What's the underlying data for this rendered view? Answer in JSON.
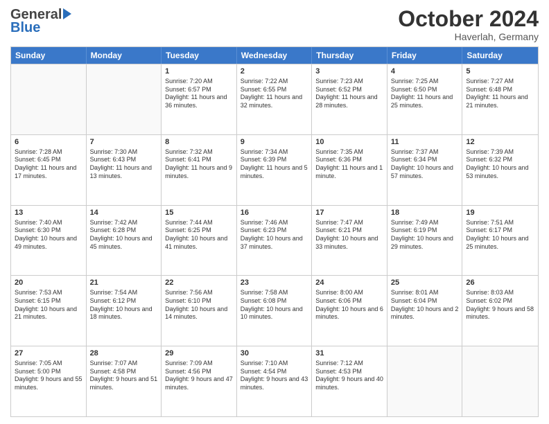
{
  "header": {
    "logo_general": "General",
    "logo_blue": "Blue",
    "month_title": "October 2024",
    "location": "Haverlah, Germany"
  },
  "days_of_week": [
    "Sunday",
    "Monday",
    "Tuesday",
    "Wednesday",
    "Thursday",
    "Friday",
    "Saturday"
  ],
  "weeks": [
    [
      {
        "day": "",
        "sunrise": "",
        "sunset": "",
        "daylight": "",
        "empty": true
      },
      {
        "day": "",
        "sunrise": "",
        "sunset": "",
        "daylight": "",
        "empty": true
      },
      {
        "day": "1",
        "sunrise": "Sunrise: 7:20 AM",
        "sunset": "Sunset: 6:57 PM",
        "daylight": "Daylight: 11 hours and 36 minutes.",
        "empty": false
      },
      {
        "day": "2",
        "sunrise": "Sunrise: 7:22 AM",
        "sunset": "Sunset: 6:55 PM",
        "daylight": "Daylight: 11 hours and 32 minutes.",
        "empty": false
      },
      {
        "day": "3",
        "sunrise": "Sunrise: 7:23 AM",
        "sunset": "Sunset: 6:52 PM",
        "daylight": "Daylight: 11 hours and 28 minutes.",
        "empty": false
      },
      {
        "day": "4",
        "sunrise": "Sunrise: 7:25 AM",
        "sunset": "Sunset: 6:50 PM",
        "daylight": "Daylight: 11 hours and 25 minutes.",
        "empty": false
      },
      {
        "day": "5",
        "sunrise": "Sunrise: 7:27 AM",
        "sunset": "Sunset: 6:48 PM",
        "daylight": "Daylight: 11 hours and 21 minutes.",
        "empty": false
      }
    ],
    [
      {
        "day": "6",
        "sunrise": "Sunrise: 7:28 AM",
        "sunset": "Sunset: 6:45 PM",
        "daylight": "Daylight: 11 hours and 17 minutes.",
        "empty": false
      },
      {
        "day": "7",
        "sunrise": "Sunrise: 7:30 AM",
        "sunset": "Sunset: 6:43 PM",
        "daylight": "Daylight: 11 hours and 13 minutes.",
        "empty": false
      },
      {
        "day": "8",
        "sunrise": "Sunrise: 7:32 AM",
        "sunset": "Sunset: 6:41 PM",
        "daylight": "Daylight: 11 hours and 9 minutes.",
        "empty": false
      },
      {
        "day": "9",
        "sunrise": "Sunrise: 7:34 AM",
        "sunset": "Sunset: 6:39 PM",
        "daylight": "Daylight: 11 hours and 5 minutes.",
        "empty": false
      },
      {
        "day": "10",
        "sunrise": "Sunrise: 7:35 AM",
        "sunset": "Sunset: 6:36 PM",
        "daylight": "Daylight: 11 hours and 1 minute.",
        "empty": false
      },
      {
        "day": "11",
        "sunrise": "Sunrise: 7:37 AM",
        "sunset": "Sunset: 6:34 PM",
        "daylight": "Daylight: 10 hours and 57 minutes.",
        "empty": false
      },
      {
        "day": "12",
        "sunrise": "Sunrise: 7:39 AM",
        "sunset": "Sunset: 6:32 PM",
        "daylight": "Daylight: 10 hours and 53 minutes.",
        "empty": false
      }
    ],
    [
      {
        "day": "13",
        "sunrise": "Sunrise: 7:40 AM",
        "sunset": "Sunset: 6:30 PM",
        "daylight": "Daylight: 10 hours and 49 minutes.",
        "empty": false
      },
      {
        "day": "14",
        "sunrise": "Sunrise: 7:42 AM",
        "sunset": "Sunset: 6:28 PM",
        "daylight": "Daylight: 10 hours and 45 minutes.",
        "empty": false
      },
      {
        "day": "15",
        "sunrise": "Sunrise: 7:44 AM",
        "sunset": "Sunset: 6:25 PM",
        "daylight": "Daylight: 10 hours and 41 minutes.",
        "empty": false
      },
      {
        "day": "16",
        "sunrise": "Sunrise: 7:46 AM",
        "sunset": "Sunset: 6:23 PM",
        "daylight": "Daylight: 10 hours and 37 minutes.",
        "empty": false
      },
      {
        "day": "17",
        "sunrise": "Sunrise: 7:47 AM",
        "sunset": "Sunset: 6:21 PM",
        "daylight": "Daylight: 10 hours and 33 minutes.",
        "empty": false
      },
      {
        "day": "18",
        "sunrise": "Sunrise: 7:49 AM",
        "sunset": "Sunset: 6:19 PM",
        "daylight": "Daylight: 10 hours and 29 minutes.",
        "empty": false
      },
      {
        "day": "19",
        "sunrise": "Sunrise: 7:51 AM",
        "sunset": "Sunset: 6:17 PM",
        "daylight": "Daylight: 10 hours and 25 minutes.",
        "empty": false
      }
    ],
    [
      {
        "day": "20",
        "sunrise": "Sunrise: 7:53 AM",
        "sunset": "Sunset: 6:15 PM",
        "daylight": "Daylight: 10 hours and 21 minutes.",
        "empty": false
      },
      {
        "day": "21",
        "sunrise": "Sunrise: 7:54 AM",
        "sunset": "Sunset: 6:12 PM",
        "daylight": "Daylight: 10 hours and 18 minutes.",
        "empty": false
      },
      {
        "day": "22",
        "sunrise": "Sunrise: 7:56 AM",
        "sunset": "Sunset: 6:10 PM",
        "daylight": "Daylight: 10 hours and 14 minutes.",
        "empty": false
      },
      {
        "day": "23",
        "sunrise": "Sunrise: 7:58 AM",
        "sunset": "Sunset: 6:08 PM",
        "daylight": "Daylight: 10 hours and 10 minutes.",
        "empty": false
      },
      {
        "day": "24",
        "sunrise": "Sunrise: 8:00 AM",
        "sunset": "Sunset: 6:06 PM",
        "daylight": "Daylight: 10 hours and 6 minutes.",
        "empty": false
      },
      {
        "day": "25",
        "sunrise": "Sunrise: 8:01 AM",
        "sunset": "Sunset: 6:04 PM",
        "daylight": "Daylight: 10 hours and 2 minutes.",
        "empty": false
      },
      {
        "day": "26",
        "sunrise": "Sunrise: 8:03 AM",
        "sunset": "Sunset: 6:02 PM",
        "daylight": "Daylight: 9 hours and 58 minutes.",
        "empty": false
      }
    ],
    [
      {
        "day": "27",
        "sunrise": "Sunrise: 7:05 AM",
        "sunset": "Sunset: 5:00 PM",
        "daylight": "Daylight: 9 hours and 55 minutes.",
        "empty": false
      },
      {
        "day": "28",
        "sunrise": "Sunrise: 7:07 AM",
        "sunset": "Sunset: 4:58 PM",
        "daylight": "Daylight: 9 hours and 51 minutes.",
        "empty": false
      },
      {
        "day": "29",
        "sunrise": "Sunrise: 7:09 AM",
        "sunset": "Sunset: 4:56 PM",
        "daylight": "Daylight: 9 hours and 47 minutes.",
        "empty": false
      },
      {
        "day": "30",
        "sunrise": "Sunrise: 7:10 AM",
        "sunset": "Sunset: 4:54 PM",
        "daylight": "Daylight: 9 hours and 43 minutes.",
        "empty": false
      },
      {
        "day": "31",
        "sunrise": "Sunrise: 7:12 AM",
        "sunset": "Sunset: 4:53 PM",
        "daylight": "Daylight: 9 hours and 40 minutes.",
        "empty": false
      },
      {
        "day": "",
        "sunrise": "",
        "sunset": "",
        "daylight": "",
        "empty": true
      },
      {
        "day": "",
        "sunrise": "",
        "sunset": "",
        "daylight": "",
        "empty": true
      }
    ]
  ]
}
